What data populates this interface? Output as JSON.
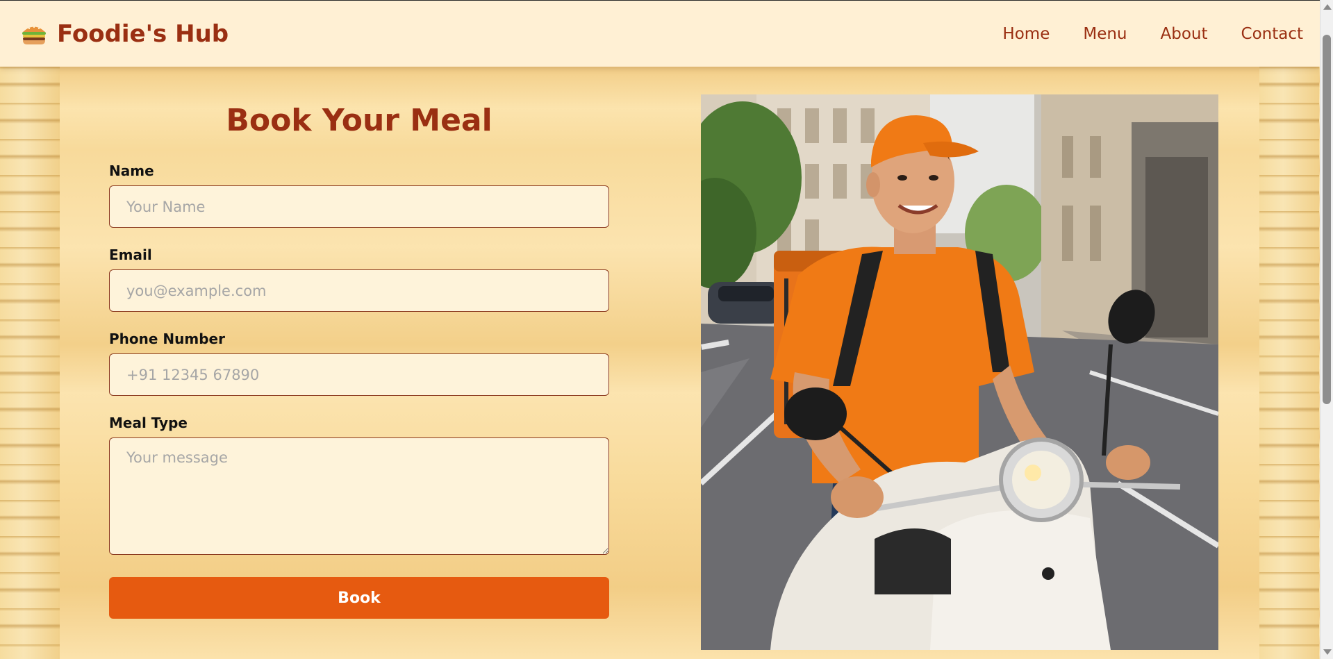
{
  "brand": {
    "name": "Foodie's Hub",
    "icon": "burger-icon"
  },
  "nav": {
    "items": [
      {
        "label": "Home"
      },
      {
        "label": "Menu"
      },
      {
        "label": "About"
      },
      {
        "label": "Contact"
      }
    ]
  },
  "form": {
    "title": "Book Your Meal",
    "name": {
      "label": "Name",
      "placeholder": "Your Name",
      "value": ""
    },
    "email": {
      "label": "Email",
      "placeholder": "you@example.com",
      "value": ""
    },
    "phone": {
      "label": "Phone Number",
      "placeholder": "+91 12345 67890",
      "value": ""
    },
    "meal": {
      "label": "Meal Type",
      "placeholder": "Your message",
      "value": ""
    },
    "submit_label": "Book"
  },
  "hero_image": {
    "subject": "delivery-rider-on-scooter-photo"
  },
  "colors": {
    "brand": "#9a2f12",
    "button": "#e65a10",
    "header_bg": "#fff0d4",
    "input_bg": "#fef3da"
  }
}
